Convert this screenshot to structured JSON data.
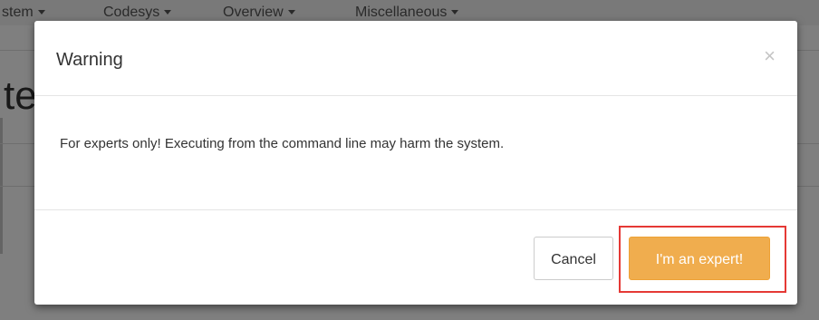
{
  "navbar": {
    "items": [
      {
        "label": "stem"
      },
      {
        "label": "Codesys"
      },
      {
        "label": "Overview"
      },
      {
        "label": "Miscellaneous"
      }
    ]
  },
  "page": {
    "heading": "te"
  },
  "modal": {
    "title": "Warning",
    "close_symbol": "×",
    "body_text": "For experts only! Executing from the command line may harm the system.",
    "cancel_label": "Cancel",
    "confirm_label": "I'm an expert!"
  },
  "colors": {
    "confirm_button": "#f0ad4e",
    "highlight_border": "#e53935"
  }
}
